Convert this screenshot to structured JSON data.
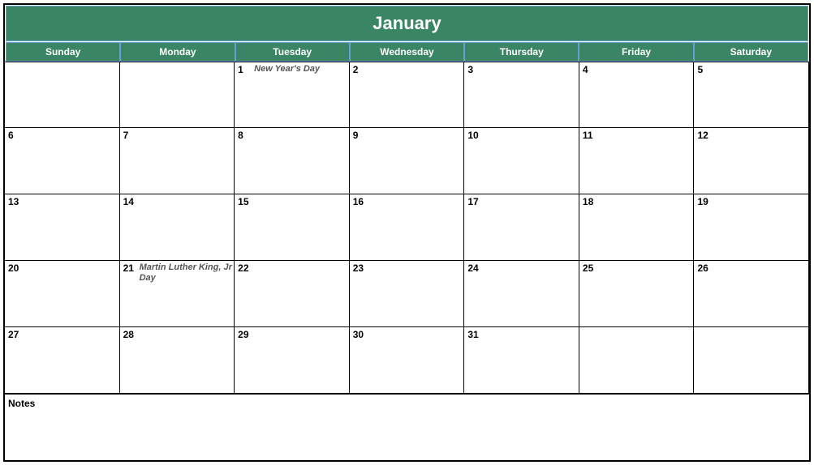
{
  "title": "January",
  "days_of_week": [
    "Sunday",
    "Monday",
    "Tuesday",
    "Wednesday",
    "Thursday",
    "Friday",
    "Saturday"
  ],
  "weeks": [
    [
      {
        "num": "",
        "event": ""
      },
      {
        "num": "",
        "event": ""
      },
      {
        "num": "1",
        "event": "New Year's Day"
      },
      {
        "num": "2",
        "event": ""
      },
      {
        "num": "3",
        "event": ""
      },
      {
        "num": "4",
        "event": ""
      },
      {
        "num": "5",
        "event": ""
      }
    ],
    [
      {
        "num": "6",
        "event": ""
      },
      {
        "num": "7",
        "event": ""
      },
      {
        "num": "8",
        "event": ""
      },
      {
        "num": "9",
        "event": ""
      },
      {
        "num": "10",
        "event": ""
      },
      {
        "num": "11",
        "event": ""
      },
      {
        "num": "12",
        "event": ""
      }
    ],
    [
      {
        "num": "13",
        "event": ""
      },
      {
        "num": "14",
        "event": ""
      },
      {
        "num": "15",
        "event": ""
      },
      {
        "num": "16",
        "event": ""
      },
      {
        "num": "17",
        "event": ""
      },
      {
        "num": "18",
        "event": ""
      },
      {
        "num": "19",
        "event": ""
      }
    ],
    [
      {
        "num": "20",
        "event": ""
      },
      {
        "num": "21",
        "event": "Martin Luther King, Jr Day"
      },
      {
        "num": "22",
        "event": ""
      },
      {
        "num": "23",
        "event": ""
      },
      {
        "num": "24",
        "event": ""
      },
      {
        "num": "25",
        "event": ""
      },
      {
        "num": "26",
        "event": ""
      }
    ],
    [
      {
        "num": "27",
        "event": ""
      },
      {
        "num": "28",
        "event": ""
      },
      {
        "num": "29",
        "event": ""
      },
      {
        "num": "30",
        "event": ""
      },
      {
        "num": "31",
        "event": ""
      },
      {
        "num": "",
        "event": ""
      },
      {
        "num": "",
        "event": ""
      }
    ]
  ],
  "notes_label": "Notes"
}
